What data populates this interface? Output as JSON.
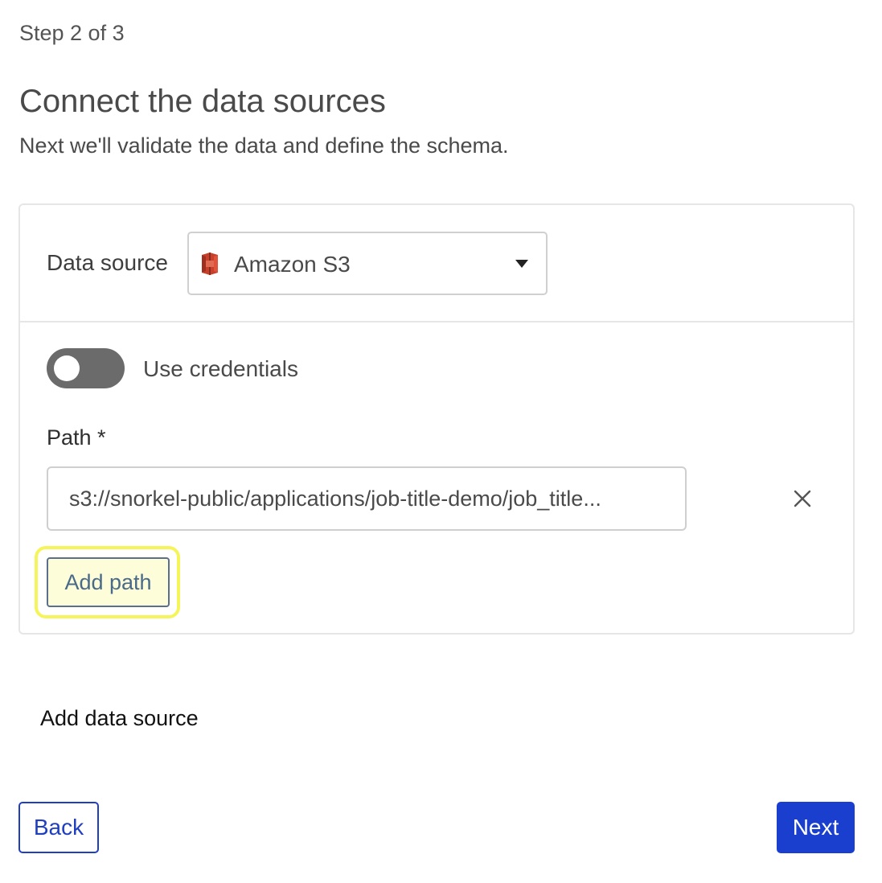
{
  "header": {
    "step": "Step 2 of 3",
    "title": "Connect the data sources",
    "subtitle": "Next we'll validate the data and define the schema."
  },
  "data_source": {
    "label": "Data source",
    "selected": "Amazon S3",
    "icon": "amazon-s3-icon",
    "icon_color": "#c7402b"
  },
  "credentials": {
    "label": "Use credentials",
    "enabled": false
  },
  "path": {
    "label": "Path *",
    "value": "s3://snorkel-public/applications/job-title-demo/job_title..."
  },
  "buttons": {
    "add_path": "Add path",
    "add_data_source": "Add data source",
    "back": "Back",
    "next": "Next"
  },
  "colors": {
    "primary": "#1a3fcf",
    "highlight": "#f5f55a"
  }
}
